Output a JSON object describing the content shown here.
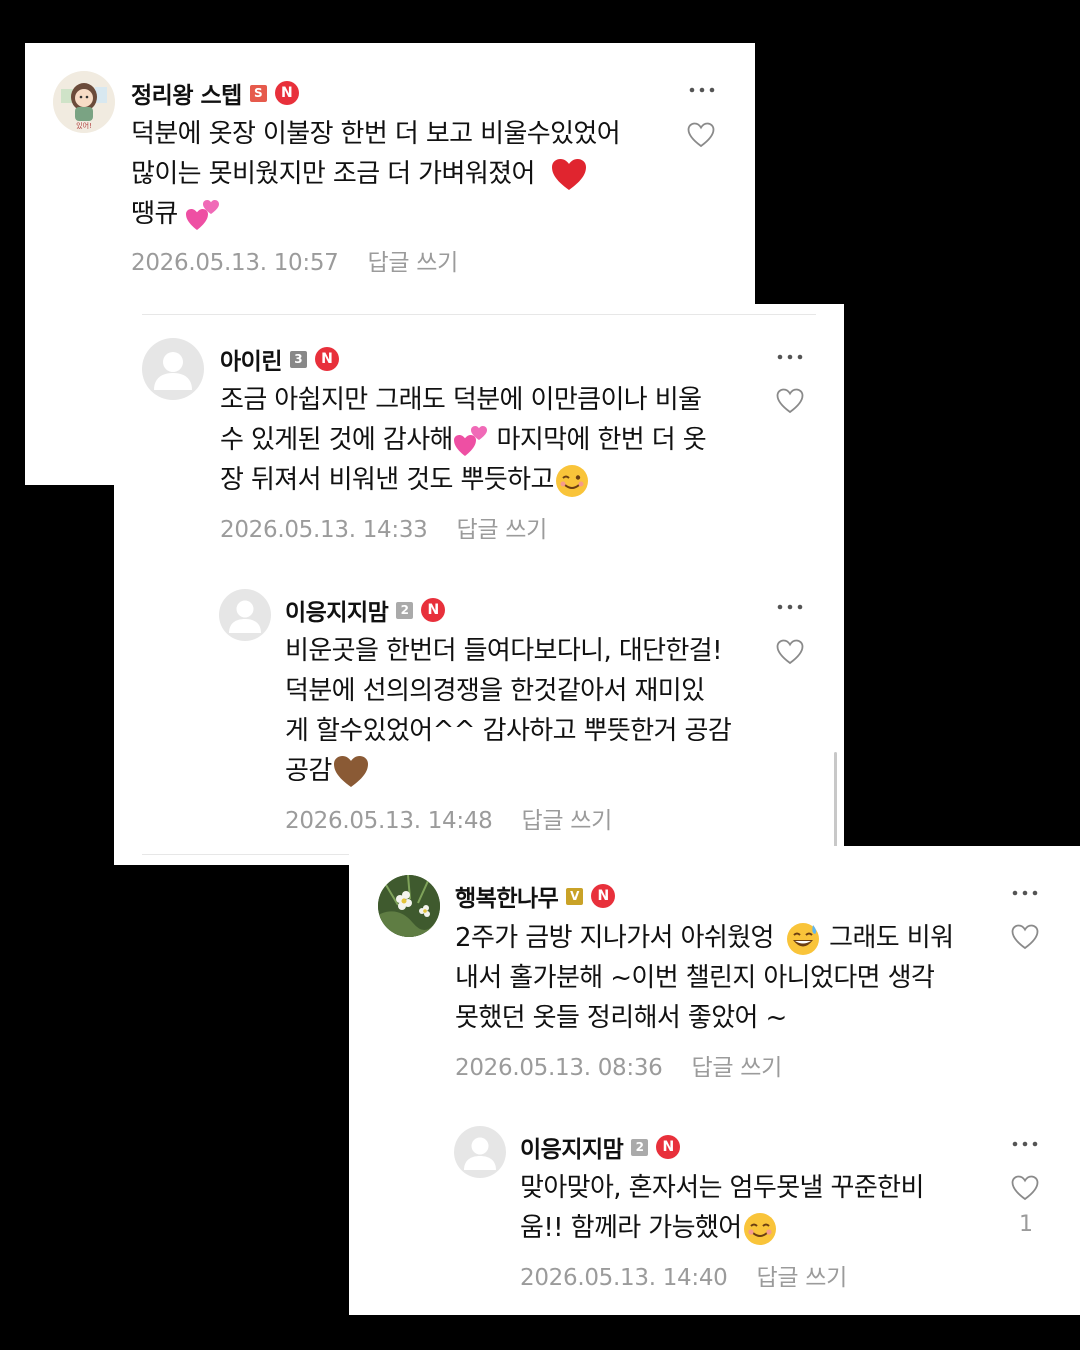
{
  "reply_label": "답글 쓰기",
  "colors": {
    "n_badge": "#e8303b",
    "muted": "#9b9b9b"
  },
  "comments": [
    {
      "author": "정리왕 스텝",
      "level": "S",
      "badge": "N",
      "lines": [
        "덕분에 옷장 이불장 한번 더 보고 비울수있었어",
        "많이는 못비웠지만 조금 더 가벼워졌어",
        "땡큐"
      ],
      "emojis": [
        "red-heart",
        "two-hearts"
      ],
      "avatar_text": "있어!",
      "timestamp": "2026.05.13. 10:57"
    },
    {
      "author": "아이린",
      "level": "3",
      "badge": "N",
      "lines": [
        "조금 아쉽지만 그래도 덕분에 이만큼이나 비울",
        "수 있게된 것에 감사해",
        " 마지막에 한번 더 옷",
        "장 뒤져서 비워낸 것도 뿌듯하고"
      ],
      "emojis": [
        "two-hearts",
        "winking-face"
      ],
      "timestamp": "2026.05.13. 14:33"
    },
    {
      "author": "이응지지맘",
      "level": "2",
      "badge": "N",
      "lines": [
        "비운곳을 한번더 들여다보다니, 대단한걸!",
        "덕분에 선의의경쟁을 한것같아서 재미있",
        "게 할수있었어^^ 감사하고 뿌뜻한거 공감",
        "공감"
      ],
      "emojis": [
        "brown-heart"
      ],
      "timestamp": "2026.05.13. 14:48"
    },
    {
      "author": "행복한나무",
      "level": "V",
      "badge": "N",
      "lines": [
        "2주가 금방 지나가서 아쉬웠엉",
        " 그래도 비워",
        "내서 홀가분해 ~이번 챌린지 아니었다면 생각",
        "못했던 옷들 정리해서 좋았어 ~"
      ],
      "emojis": [
        "grinning-sweat-face"
      ],
      "timestamp": "2026.05.13. 08:36"
    },
    {
      "author": "이응지지맘",
      "level": "2",
      "badge": "N",
      "lines": [
        "맞아맞아, 혼자서는 엄두못낼 꾸준한비",
        "움!! 함께라 가능했어"
      ],
      "emojis": [
        "smiling-face"
      ],
      "like_count": "1",
      "timestamp": "2026.05.13. 14:40"
    }
  ]
}
